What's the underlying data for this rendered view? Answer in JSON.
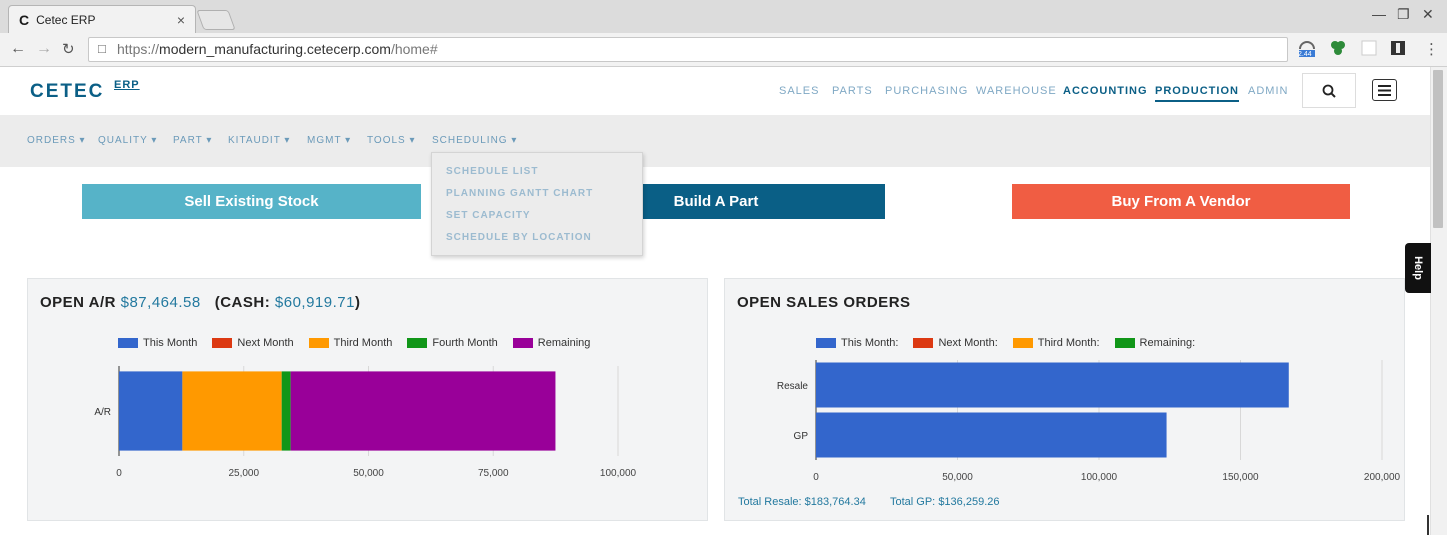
{
  "browser": {
    "tab_title": "Cetec ERP",
    "tab_close": "×",
    "url_scheme": "https://",
    "url_host": "modern_manufacturing.cetecerp.com",
    "url_path": "/home#",
    "ext_badge": "2.44"
  },
  "header": {
    "logo": "CETEC",
    "logo_sub": "ERP",
    "nav": [
      "SALES",
      "PARTS",
      "PURCHASING",
      "WAREHOUSE",
      "ACCOUNTING",
      "PRODUCTION",
      "ADMIN"
    ]
  },
  "subnav": {
    "items": [
      "ORDERS ▾",
      "QUALITY ▾",
      "PART ▾",
      "KITAUDIT ▾",
      "MGMT ▾",
      "TOOLS ▾",
      "SCHEDULING ▾"
    ],
    "dropdown": [
      "SCHEDULE LIST",
      "PLANNING GANTT CHART",
      "SET CAPACITY",
      "SCHEDULE BY LOCATION"
    ]
  },
  "actions": {
    "sell": "Sell Existing Stock",
    "build": "Build A Part",
    "buy": "Buy From A Vendor"
  },
  "help_label": "Help",
  "colors": {
    "brand": "#0b5f86",
    "sell": "#56b3c8",
    "build": "#0a5f86",
    "buy": "#f05d43",
    "blue": "#3366cc",
    "red": "#dc3912",
    "orange": "#ff9900",
    "green": "#109618",
    "purple": "#990099"
  },
  "ar_panel": {
    "title_prefix": "OPEN A/R",
    "ar_amount": "$87,464.58",
    "cash_prefix": "(CASH:",
    "cash_amount": "$60,919.71",
    "cash_suffix": ")"
  },
  "sales_panel": {
    "title": "OPEN SALES ORDERS",
    "total_resale_label": "Total Resale:",
    "total_resale_value": "$183,764.34",
    "total_gp_label": "Total GP:",
    "total_gp_value": "$136,259.26"
  },
  "chart_data": [
    {
      "type": "bar",
      "orientation": "horizontal",
      "stacked": true,
      "categories": [
        "A/R"
      ],
      "series": [
        {
          "name": "This Month",
          "values": [
            12700
          ]
        },
        {
          "name": "Next Month",
          "values": [
            0
          ]
        },
        {
          "name": "Third Month",
          "values": [
            19900
          ]
        },
        {
          "name": "Fourth Month",
          "values": [
            1800
          ]
        },
        {
          "name": "Remaining",
          "values": [
            53064.58
          ]
        }
      ],
      "xlim": [
        0,
        100000
      ],
      "xticks": [
        "0",
        "25,000",
        "50,000",
        "75,000",
        "100,000"
      ],
      "legend": "top",
      "grid": true
    },
    {
      "type": "bar",
      "orientation": "horizontal",
      "stacked": true,
      "categories": [
        "Resale",
        "GP"
      ],
      "series": [
        {
          "name": "This Month:",
          "values": [
            183764.34,
            136259.26
          ]
        },
        {
          "name": "Next Month:",
          "values": [
            0,
            0
          ]
        },
        {
          "name": "Third Month:",
          "values": [
            0,
            0
          ]
        },
        {
          "name": "Remaining:",
          "values": [
            0,
            0
          ]
        }
      ],
      "xlim": [
        0,
        220000
      ],
      "xticks": [
        "0",
        "50,000",
        "100,000",
        "150,000",
        "200,000"
      ],
      "legend": "top",
      "grid": true
    }
  ]
}
